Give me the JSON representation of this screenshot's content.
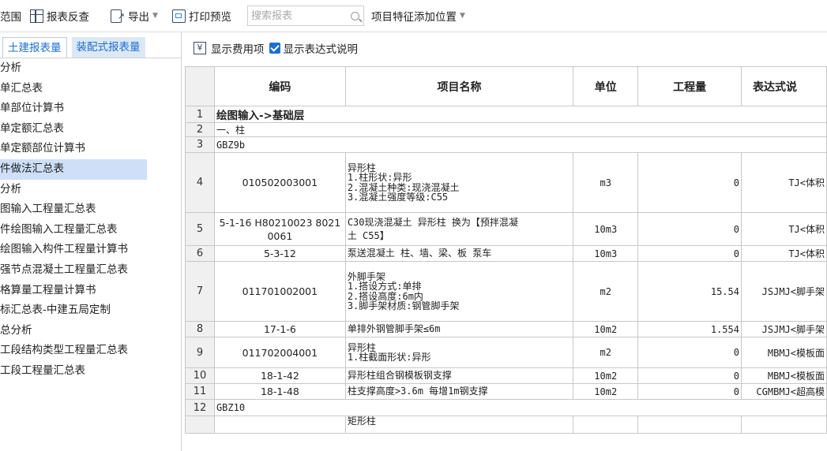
{
  "toolbar": {
    "scope_label": "范围",
    "report_check_label": "报表反查",
    "export_label": "导出",
    "print_preview_label": "打印预览",
    "search_placeholder": "搜索报表",
    "feature_position_label": "项目特征添加位置"
  },
  "left_panel": {
    "tabs": [
      {
        "label": "土建报表量",
        "active": true
      },
      {
        "label": "装配式报表量",
        "active": false
      }
    ],
    "items": [
      {
        "label": "分析"
      },
      {
        "label": "单汇总表"
      },
      {
        "label": "单部位计算书"
      },
      {
        "label": "单定额汇总表"
      },
      {
        "label": "单定额部位计算书"
      },
      {
        "label": "件做法汇总表",
        "selected": true
      },
      {
        "label": "分析"
      },
      {
        "label": "图输入工程量汇总表"
      },
      {
        "label": "件绘图输入工程量汇总表"
      },
      {
        "label": "绘图输入构件工程量计算书"
      },
      {
        "label": "强节点混凝土工程量汇总表"
      },
      {
        "label": "格算量工程量计算书"
      },
      {
        "label": "标汇总表-中建五局定制"
      },
      {
        "label": "总分析"
      },
      {
        "label": "工段结构类型工程量汇总表"
      },
      {
        "label": "工段工程量汇总表"
      }
    ]
  },
  "right_panel": {
    "show_fee_label": "显示费用项",
    "show_expr_label": "显示表达式说明",
    "show_expr_checked": true,
    "columns": [
      "编码",
      "项目名称",
      "单位",
      "工程量",
      "表达式说"
    ],
    "rows": [
      {
        "n": "1",
        "span": "绘图输入->基础层",
        "bold": true
      },
      {
        "n": "2",
        "span": "一、柱"
      },
      {
        "n": "3",
        "span": "GBZ9b"
      },
      {
        "n": "4",
        "code": "010502003001",
        "name": "异形柱\n1.柱形状:异形\n2.混凝土种类:现浇混凝土\n3.混凝土强度等级:C55",
        "unit": "m3",
        "qty": "0",
        "expr": "TJ<体积"
      },
      {
        "n": "5",
        "code": "5-1-16 H80210023 8021\n0061",
        "name": "C30现浇混凝土 异形柱  换为【预拌混凝\n土 C55】",
        "unit": "10m3",
        "qty": "0",
        "expr": "TJ<体积"
      },
      {
        "n": "6",
        "code": "5-3-12",
        "name": "泵送混凝土 柱、墙、梁、板 泵车",
        "unit": "10m3",
        "qty": "0",
        "expr": "TJ<体积"
      },
      {
        "n": "7",
        "code": "011701002001",
        "name": "外脚手架\n1.搭设方式:单排\n2.搭设高度:6m内\n3.脚手架材质:钢管脚手架",
        "unit": "m2",
        "qty": "15.54",
        "expr": "JSJMJ<脚手架"
      },
      {
        "n": "8",
        "code": "17-1-6",
        "name": "单排外钢管脚手架≤6m",
        "unit": "10m2",
        "qty": "1.554",
        "expr": "JSJMJ<脚手架"
      },
      {
        "n": "9",
        "code": "011702004001",
        "name": "异形柱\n1.柱截面形状:异形",
        "unit": "m2",
        "qty": "0",
        "expr": "MBMJ<模板面"
      },
      {
        "n": "10",
        "code": "18-1-42",
        "name": "异形柱组合钢模板钢支撑",
        "unit": "10m2",
        "qty": "0",
        "expr": "MBMJ<模板面"
      },
      {
        "n": "11",
        "code": "18-1-48",
        "name": "柱支撑高度>3.6m 每增1m钢支撑",
        "unit": "10m2",
        "qty": "0",
        "expr": "CGMBMJ<超高模"
      },
      {
        "n": "12",
        "span": "GBZ10"
      },
      {
        "n": "",
        "code": "",
        "name": "矩形柱",
        "unit": "",
        "qty": "",
        "expr": ""
      }
    ]
  }
}
